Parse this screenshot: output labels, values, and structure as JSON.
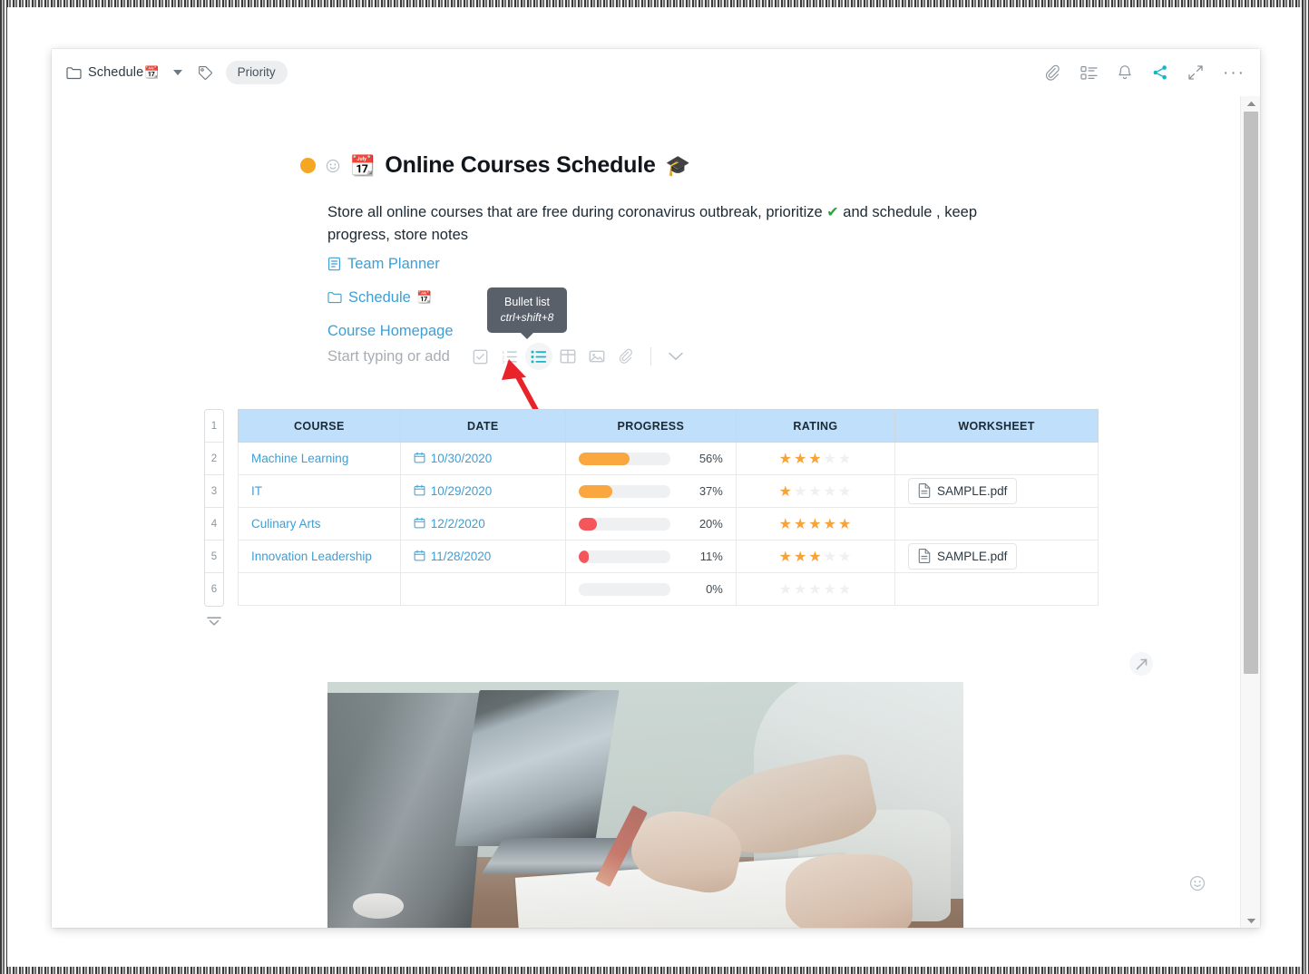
{
  "topbar": {
    "breadcrumb_label": "Schedule",
    "breadcrumb_emoji": "📆",
    "folder_icon": "folder-icon",
    "caret_icon": "chevron-down-icon",
    "tag_icon": "tag-icon",
    "priority_chip": "Priority",
    "icons": [
      {
        "name": "attachment-icon",
        "glyph": "paperclip"
      },
      {
        "name": "board-view-icon",
        "glyph": "list-grid"
      },
      {
        "name": "notifications-icon",
        "glyph": "bell"
      },
      {
        "name": "share-icon",
        "glyph": "share",
        "color": "#17b3c8"
      },
      {
        "name": "expand-icon",
        "glyph": "diagonal-arrows"
      },
      {
        "name": "more-options-icon",
        "glyph": "ellipsis"
      }
    ],
    "more_label": "···"
  },
  "document": {
    "status_dot_color": "#f5a623",
    "reaction_icon": "smiley-icon",
    "title_emoji": "📆",
    "title": "Online Courses Schedule",
    "title_trailing_emoji": "🎓",
    "description_before": "Store all online courses that are free during coronavirus outbreak, prioritize",
    "description_check": "✔",
    "description_after": "and schedule , keep progress, store notes",
    "links": [
      {
        "icon": "document-icon",
        "label": "Team Planner"
      },
      {
        "icon": "folder-icon",
        "label": "Schedule",
        "emoji": "📆"
      },
      {
        "icon": "none",
        "label": "Course Homepage"
      }
    ]
  },
  "add_toolbar": {
    "placeholder": "Start typing or add",
    "buttons": [
      {
        "name": "checklist-button",
        "icon": "checkbox-icon",
        "active": false
      },
      {
        "name": "numbered-list-button",
        "icon": "numbered-list-icon",
        "active": false
      },
      {
        "name": "bullet-list-button",
        "icon": "bullet-list-icon",
        "active": true
      },
      {
        "name": "table-button",
        "icon": "table-icon",
        "active": false
      },
      {
        "name": "image-button",
        "icon": "image-icon",
        "active": false
      },
      {
        "name": "attachment-button",
        "icon": "paperclip-icon",
        "active": false
      },
      {
        "name": "more-blocks-button",
        "icon": "chevron-down-icon",
        "active": false
      }
    ]
  },
  "tooltip": {
    "title": "Bullet list",
    "shortcut": "ctrl+shift+8"
  },
  "annotation": {
    "arrow_color": "#e8232a"
  },
  "table": {
    "row_numbers": [
      "1",
      "2",
      "3",
      "4",
      "5",
      "6"
    ],
    "collapse_icon": "collapse-rows-icon",
    "resize_icon": "resize-handle-icon",
    "header_bg": "#bfdffa",
    "columns": [
      "COURSE",
      "DATE",
      "PROGRESS",
      "RATING",
      "WORKSHEET"
    ],
    "rows": [
      {
        "course": "Machine Learning",
        "date": "10/30/2020",
        "progress": 56,
        "progress_label": "56%",
        "progress_color": "#f9a73e",
        "rating": 3,
        "worksheet": ""
      },
      {
        "course": "IT",
        "date": "10/29/2020",
        "progress": 37,
        "progress_label": "37%",
        "progress_color": "#f9a73e",
        "rating": 1,
        "worksheet": "SAMPLE.pdf"
      },
      {
        "course": "Culinary Arts",
        "date": "12/2/2020",
        "progress": 20,
        "progress_label": "20%",
        "progress_color": "#f4565b",
        "rating": 5,
        "worksheet": ""
      },
      {
        "course": "Innovation Leadership",
        "date": "11/28/2020",
        "progress": 11,
        "progress_label": "11%",
        "progress_color": "#f4565b",
        "rating": 3,
        "worksheet": "SAMPLE.pdf"
      },
      {
        "course": "",
        "date": "",
        "progress": 0,
        "progress_label": "0%",
        "progress_color": "#eef0f1",
        "rating": 0,
        "worksheet": ""
      }
    ],
    "star_on_color": "#f7a33a",
    "star_off_color": "#eef0f1",
    "star_glyph": "★",
    "max_stars": 5
  },
  "photo": {
    "name": "meeting-photo",
    "alt": "Two people at a desk with laptops reviewing handwritten notes"
  },
  "footer": {
    "smiley_icon": "smiley-icon"
  },
  "scrollbar": {
    "up_icon": "scroll-up-icon",
    "down_icon": "scroll-down-icon"
  }
}
